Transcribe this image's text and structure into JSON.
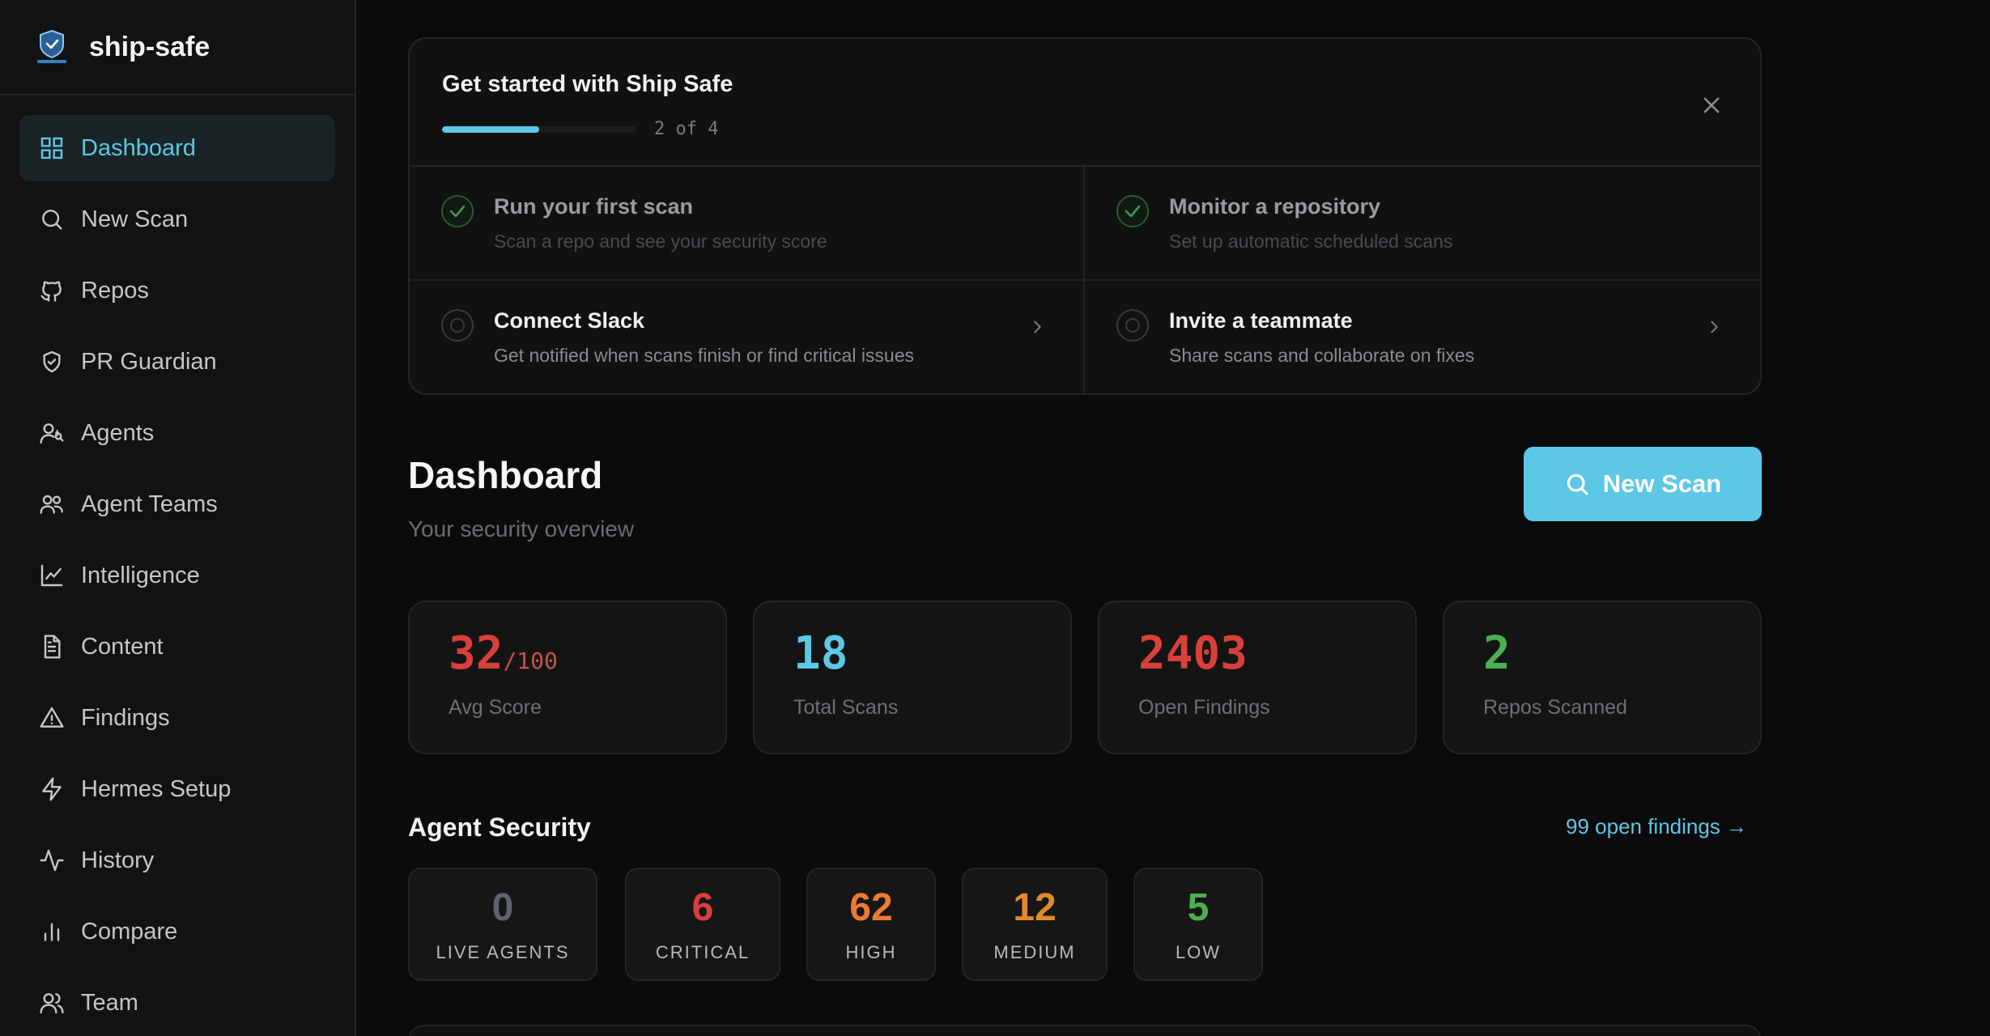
{
  "brand": {
    "name": "ship-safe"
  },
  "nav": [
    {
      "label": "Dashboard",
      "icon": "grid-icon",
      "active": true
    },
    {
      "label": "New Scan",
      "icon": "search-icon"
    },
    {
      "label": "Repos",
      "icon": "github-icon"
    },
    {
      "label": "PR Guardian",
      "icon": "shield-icon"
    },
    {
      "label": "Agents",
      "icon": "agent-icon"
    },
    {
      "label": "Agent Teams",
      "icon": "users-icon"
    },
    {
      "label": "Intelligence",
      "icon": "line-chart-icon"
    },
    {
      "label": "Content",
      "icon": "document-icon"
    },
    {
      "label": "Findings",
      "icon": "warning-icon"
    },
    {
      "label": "Hermes Setup",
      "icon": "lightning-icon"
    },
    {
      "label": "History",
      "icon": "activity-icon"
    },
    {
      "label": "Compare",
      "icon": "bar-chart-icon"
    },
    {
      "label": "Team",
      "icon": "team-icon"
    }
  ],
  "onboarding": {
    "title": "Get started with Ship Safe",
    "progress_text": "2 of 4",
    "progress": 0.5,
    "steps": [
      {
        "title": "Run your first scan",
        "desc": "Scan a repo and see your security score",
        "done": true
      },
      {
        "title": "Monitor a repository",
        "desc": "Set up automatic scheduled scans",
        "done": true
      },
      {
        "title": "Connect Slack",
        "desc": "Get notified when scans finish or find critical issues",
        "done": false
      },
      {
        "title": "Invite a teammate",
        "desc": "Share scans and collaborate on fixes",
        "done": false
      }
    ]
  },
  "header": {
    "title": "Dashboard",
    "subtitle": "Your security overview",
    "new_scan_label": "New Scan"
  },
  "stats": [
    {
      "value": "32",
      "suffix": "/100",
      "label": "Avg Score",
      "color": "#d9403a"
    },
    {
      "value": "18",
      "suffix": "",
      "label": "Total Scans",
      "color": "#5cc8e6"
    },
    {
      "value": "2403",
      "suffix": "",
      "label": "Open Findings",
      "color": "#d9403a"
    },
    {
      "value": "2",
      "suffix": "",
      "label": "Repos Scanned",
      "color": "#4caf50"
    }
  ],
  "agent_security": {
    "title": "Agent Security",
    "link": "99 open findings →",
    "cards": [
      {
        "value": "0",
        "label": "LIVE AGENTS",
        "color": "#5d6470"
      },
      {
        "value": "6",
        "label": "CRITICAL",
        "color": "#d9403a"
      },
      {
        "value": "62",
        "label": "HIGH",
        "color": "#ee7a30"
      },
      {
        "value": "12",
        "label": "MEDIUM",
        "color": "#e08a2a"
      },
      {
        "value": "5",
        "label": "LOW",
        "color": "#4caf50"
      }
    ]
  }
}
